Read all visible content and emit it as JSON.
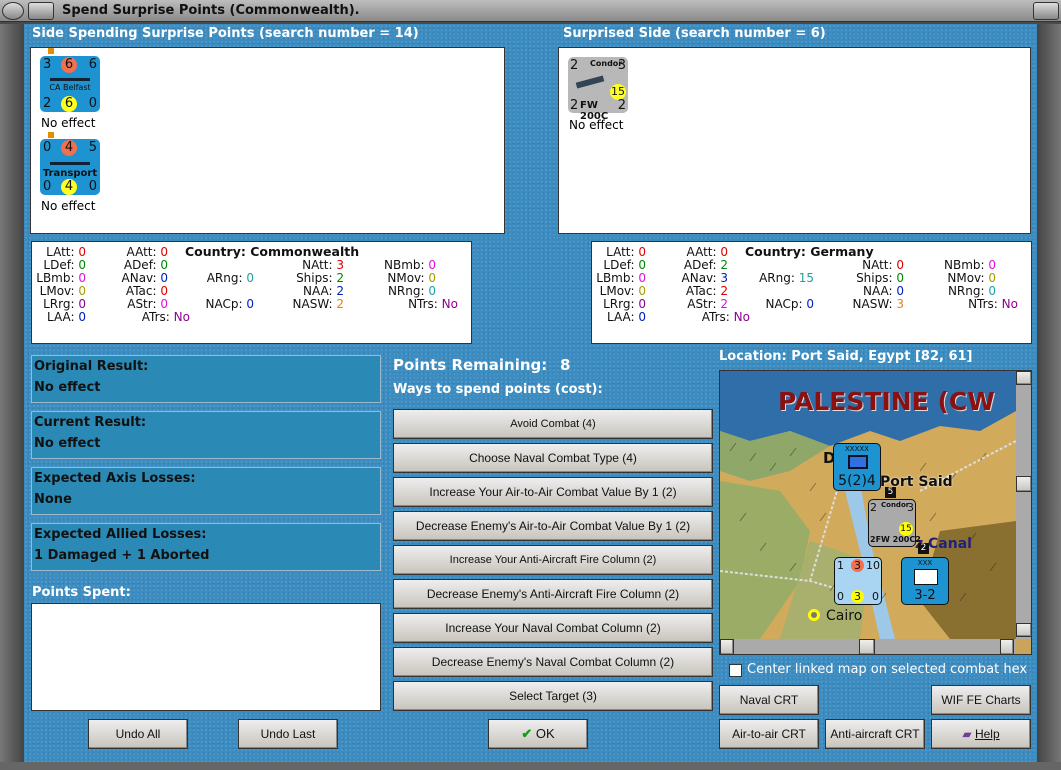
{
  "window": {
    "title": "Spend Surprise Points (Commonwealth)."
  },
  "left_side": {
    "header": "Side Spending Surprise Points (search number = 14)",
    "units": [
      {
        "name": "CA Belfast",
        "tl": "3",
        "tc": "6",
        "tr": "6",
        "bl": "2",
        "bc": "6",
        "br": "0",
        "result": "No effect"
      },
      {
        "name": "Transport",
        "tl": "0",
        "tc": "4",
        "tr": "5",
        "bl": "0",
        "bc": "4",
        "br": "0",
        "result": "No effect"
      }
    ]
  },
  "right_side": {
    "header": "Surprised Side (search number = 6)",
    "units": [
      {
        "name": "FW 200C",
        "label": "Condor",
        "tl": "2",
        "tr": "3",
        "bl": "2",
        "br": "2",
        "range": "15",
        "result": "No effect"
      }
    ]
  },
  "left_stats": {
    "country_label": "Country: Commonwealth",
    "LAtt": "0",
    "LDef": "0",
    "LBmb": "0",
    "LMov": "0",
    "LRrg": "0",
    "LAA": "0",
    "AAtt": "0",
    "ADef": "0",
    "ANav": "0",
    "ATac": "0",
    "AStr": "0",
    "ATrs": "No",
    "ARng": "0",
    "NACp": "0",
    "NAtt": "3",
    "Ships": "2",
    "NAA": "2",
    "NASW": "2",
    "NBmb": "0",
    "NMov": "0",
    "NRng": "0",
    "NTrs": "No"
  },
  "right_stats": {
    "country_label": "Country: Germany",
    "LAtt": "0",
    "LDef": "0",
    "LBmb": "0",
    "LMov": "0",
    "LRrg": "0",
    "LAA": "0",
    "AAtt": "0",
    "ADef": "2",
    "ANav": "3",
    "ATac": "2",
    "AStr": "2",
    "ATrs": "No",
    "ARng": "15",
    "NACp": "0",
    "NAtt": "0",
    "Ships": "0",
    "NAA": "0",
    "NASW": "3",
    "NBmb": "0",
    "NMov": "0",
    "NRng": "0",
    "NTrs": "No"
  },
  "results": [
    {
      "label": "Original Result:",
      "value": "No effect"
    },
    {
      "label": "Current Result:",
      "value": "No effect"
    },
    {
      "label": "Expected Axis Losses:",
      "value": "None"
    },
    {
      "label": "Expected Allied Losses:",
      "value": "1 Damaged + 1 Aborted"
    }
  ],
  "points_spent_label": "Points Spent:",
  "points_remaining_label": "Points Remaining:",
  "points_remaining": "8",
  "ways_label": "Ways to spend points (cost):",
  "options": [
    "Avoid Combat (4)",
    "Choose Naval Combat Type (4)",
    "Increase Your Air-to-Air Combat Value By 1 (2)",
    "Decrease Enemy's Air-to-Air Combat Value By 1 (2)",
    "Increase Your Anti-Aircraft Fire Column (2)",
    "Decrease Enemy's Anti-Aircraft Fire Column (2)",
    "Increase Your Naval Combat Column (2)",
    "Decrease Enemy's Naval Combat Column (2)",
    "Select Target (3)"
  ],
  "buttons": {
    "undo_all": "Undo All",
    "undo_last": "Undo Last",
    "ok": "OK",
    "naval_crt": "Naval CRT",
    "wif_charts": "WIF FE Charts",
    "air_crt": "Air-to-air CRT",
    "aa_crt": "Anti-aircraft CRT",
    "help": "Help"
  },
  "location": "Location: Port Said, Egypt [82, 61]",
  "map": {
    "region": "PALESTINE (CW",
    "city1": "Port Said",
    "city2": "Cairo",
    "canal": "z Canal",
    "partial": "D",
    "hq": {
      "size": "XXXXX",
      "val": "5(2)4"
    },
    "inf": {
      "size": "XXX",
      "val": "3-2"
    },
    "condor": {
      "tl": "2",
      "tr": "3",
      "name": "2FW 200C2",
      "label": "Condor",
      "rng": "15"
    },
    "ship": {
      "tl": "1",
      "tc": "3",
      "tr": "10",
      "bl": "0",
      "bc": "3",
      "br": "0"
    },
    "stack1": "5",
    "stack2": "2"
  },
  "center_linked": {
    "label": "Center linked map on selected combat hex",
    "checked": false
  }
}
